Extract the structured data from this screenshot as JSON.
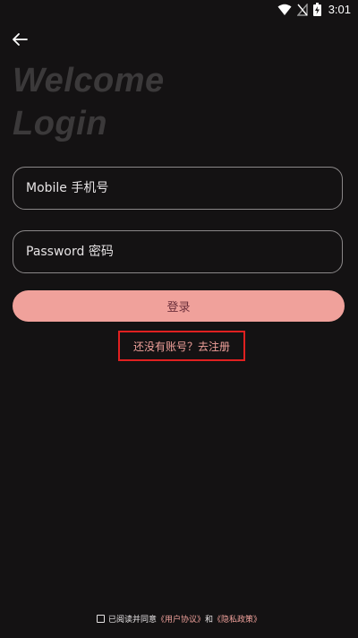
{
  "status_bar": {
    "time": "3:01",
    "icons": [
      "wifi-icon",
      "no-signal-icon",
      "battery-charging-icon"
    ]
  },
  "header": {
    "back_icon": "arrow-left-icon"
  },
  "welcome": {
    "line1": "Welcome",
    "line2": "Login"
  },
  "form": {
    "mobile_placeholder": "Mobile 手机号",
    "password_placeholder": "Password 密码",
    "login_label": "登录"
  },
  "register": {
    "label": "还没有账号？去注册",
    "highlight_color": "#e02020"
  },
  "agreement": {
    "prefix": "已阅读并同意",
    "user_agreement": "《用户协议》",
    "conjunction": "和",
    "privacy_policy": "《隐私政策》"
  },
  "colors": {
    "background": "#141213",
    "accent": "#f0a19b",
    "welcome_text": "#3b393a"
  }
}
